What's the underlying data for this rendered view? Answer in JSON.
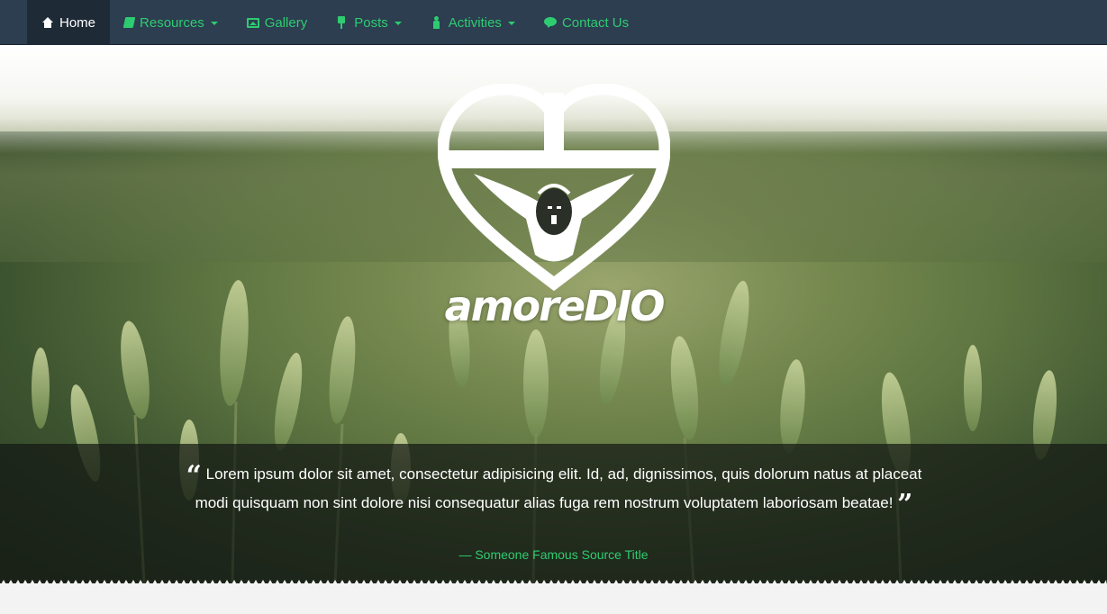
{
  "nav": {
    "items": [
      {
        "label": "Home",
        "icon": "home-icon",
        "active": true,
        "dropdown": false
      },
      {
        "label": "Resources",
        "icon": "book-icon",
        "active": false,
        "dropdown": true
      },
      {
        "label": "Gallery",
        "icon": "picture-icon",
        "active": false,
        "dropdown": false
      },
      {
        "label": "Posts",
        "icon": "pin-icon",
        "active": false,
        "dropdown": true
      },
      {
        "label": "Activities",
        "icon": "person-icon",
        "active": false,
        "dropdown": true
      },
      {
        "label": "Contact Us",
        "icon": "chat-icon",
        "active": false,
        "dropdown": false
      }
    ]
  },
  "hero": {
    "brand": "amoreDIO",
    "quote": "Lorem ipsum dolor sit amet, consectetur adipisicing elit. Id, ad, dignissimos, quis dolorum natus at placeat modi quisquam non sint dolore nisi consequatur alias fuga rem nostrum voluptatem laboriosam beatae!",
    "source": "— Someone Famous Source Title"
  },
  "colors": {
    "navbar": "#2c3e50",
    "accent": "#2ecc71",
    "active_nav": "#1e2a36"
  }
}
